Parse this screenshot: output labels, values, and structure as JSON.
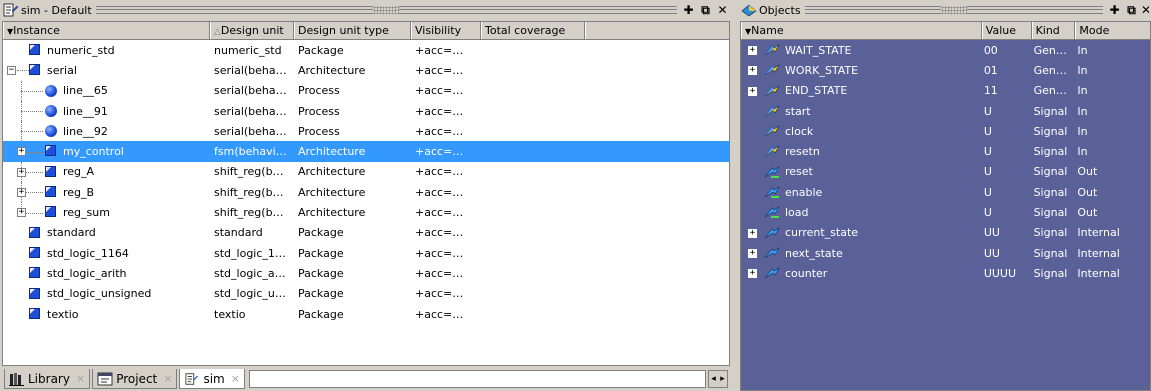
{
  "sim": {
    "title": "sim - Default",
    "columns": [
      "Instance",
      "Design unit",
      "Design unit type",
      "Visibility",
      "Total coverage"
    ],
    "rows": [
      {
        "label": "numeric_std",
        "du": "numeric_std",
        "dut": "Package",
        "vis": "+acc=…",
        "icon": "package-icon",
        "level": 0,
        "expander": "",
        "selected": false
      },
      {
        "label": "serial",
        "du": "serial(beha…",
        "dut": "Architecture",
        "vis": "+acc=…",
        "icon": "architecture-icon",
        "level": 0,
        "expander": "−",
        "selected": false
      },
      {
        "label": "line__65",
        "du": "serial(beha…",
        "dut": "Process",
        "vis": "+acc=…",
        "icon": "process-icon",
        "level": 1,
        "expander": "",
        "selected": false
      },
      {
        "label": "line__91",
        "du": "serial(beha…",
        "dut": "Process",
        "vis": "+acc=…",
        "icon": "process-icon",
        "level": 1,
        "expander": "",
        "selected": false
      },
      {
        "label": "line__92",
        "du": "serial(beha…",
        "dut": "Process",
        "vis": "+acc=…",
        "icon": "process-icon",
        "level": 1,
        "expander": "",
        "selected": false
      },
      {
        "label": "my_control",
        "du": "fsm(behavi…",
        "dut": "Architecture",
        "vis": "+acc=…",
        "icon": "architecture-icon",
        "level": 1,
        "expander": "+",
        "selected": true
      },
      {
        "label": "reg_A",
        "du": "shift_reg(b…",
        "dut": "Architecture",
        "vis": "+acc=…",
        "icon": "architecture-icon",
        "level": 1,
        "expander": "+",
        "selected": false
      },
      {
        "label": "reg_B",
        "du": "shift_reg(b…",
        "dut": "Architecture",
        "vis": "+acc=…",
        "icon": "architecture-icon",
        "level": 1,
        "expander": "+",
        "selected": false
      },
      {
        "label": "reg_sum",
        "du": "shift_reg(b…",
        "dut": "Architecture",
        "vis": "+acc=…",
        "icon": "architecture-icon",
        "level": 1,
        "expander": "+",
        "selected": false
      },
      {
        "label": "standard",
        "du": "standard",
        "dut": "Package",
        "vis": "+acc=…",
        "icon": "package-icon",
        "level": 0,
        "expander": "",
        "selected": false
      },
      {
        "label": "std_logic_1164",
        "du": "std_logic_1…",
        "dut": "Package",
        "vis": "+acc=…",
        "icon": "package-icon",
        "level": 0,
        "expander": "",
        "selected": false
      },
      {
        "label": "std_logic_arith",
        "du": "std_logic_a…",
        "dut": "Package",
        "vis": "+acc=…",
        "icon": "package-icon",
        "level": 0,
        "expander": "",
        "selected": false
      },
      {
        "label": "std_logic_unsigned",
        "du": "std_logic_u…",
        "dut": "Package",
        "vis": "+acc=…",
        "icon": "package-icon",
        "level": 0,
        "expander": "",
        "selected": false
      },
      {
        "label": "textio",
        "du": "textio",
        "dut": "Package",
        "vis": "+acc=…",
        "icon": "package-icon",
        "level": 0,
        "expander": "",
        "selected": false
      }
    ],
    "tabs": [
      {
        "label": "Library",
        "icon": "library-icon",
        "active": false
      },
      {
        "label": "Project",
        "icon": "project-icon",
        "active": false
      },
      {
        "label": "sim",
        "icon": "sim-icon",
        "active": true
      }
    ],
    "tab_close": "×"
  },
  "objects": {
    "title": "Objects",
    "columns": [
      "Name",
      "Value",
      "Kind",
      "Mode"
    ],
    "rows": [
      {
        "name": "WAIT_STATE",
        "value": "00",
        "kind": "Gen…",
        "mode": "In",
        "expander": "+",
        "dir": "in"
      },
      {
        "name": "WORK_STATE",
        "value": "01",
        "kind": "Gen…",
        "mode": "In",
        "expander": "+",
        "dir": "in"
      },
      {
        "name": "END_STATE",
        "value": "11",
        "kind": "Gen…",
        "mode": "In",
        "expander": "+",
        "dir": "in"
      },
      {
        "name": "start",
        "value": "U",
        "kind": "Signal",
        "mode": "In",
        "expander": "",
        "dir": "in"
      },
      {
        "name": "clock",
        "value": "U",
        "kind": "Signal",
        "mode": "In",
        "expander": "",
        "dir": "in"
      },
      {
        "name": "resetn",
        "value": "U",
        "kind": "Signal",
        "mode": "In",
        "expander": "",
        "dir": "in"
      },
      {
        "name": "reset",
        "value": "U",
        "kind": "Signal",
        "mode": "Out",
        "expander": "",
        "dir": "out"
      },
      {
        "name": "enable",
        "value": "U",
        "kind": "Signal",
        "mode": "Out",
        "expander": "",
        "dir": "out"
      },
      {
        "name": "load",
        "value": "U",
        "kind": "Signal",
        "mode": "Out",
        "expander": "",
        "dir": "out"
      },
      {
        "name": "current_state",
        "value": "UU",
        "kind": "Signal",
        "mode": "Internal",
        "expander": "+",
        "dir": "internal"
      },
      {
        "name": "next_state",
        "value": "UU",
        "kind": "Signal",
        "mode": "Internal",
        "expander": "+",
        "dir": "internal"
      },
      {
        "name": "counter",
        "value": "UUUU",
        "kind": "Signal",
        "mode": "Internal",
        "expander": "+",
        "dir": "internal"
      }
    ]
  },
  "colors": {
    "selection": "#3399ff",
    "objects_bg": "#5a6199",
    "icon_blue": "#1f4ed8"
  }
}
